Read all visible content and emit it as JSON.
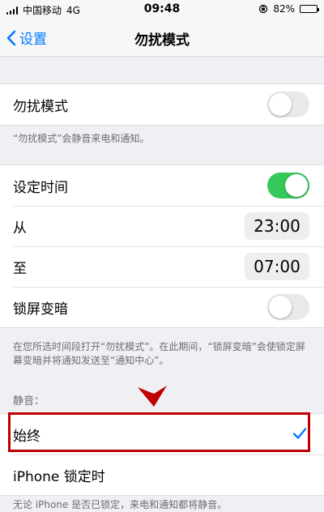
{
  "status_bar": {
    "carrier": "中国移动",
    "network": "4G",
    "time": "09:48",
    "battery": "82%"
  },
  "nav": {
    "back_label": "设置",
    "title": "勿扰模式"
  },
  "dnd": {
    "label": "勿扰模式",
    "enabled": false,
    "footnote": "“勿扰模式”会静音来电和通知。"
  },
  "schedule": {
    "label": "设定时间",
    "enabled": true,
    "from_label": "从",
    "from_time": "23:00",
    "to_label": "至",
    "to_time": "07:00",
    "dim_label": "锁屏变暗",
    "dim_enabled": false,
    "footnote": "在您所选时间段打开“勿扰模式”。在此期间，“锁屏变暗”会使锁定屏幕变暗并将通知发送至“通知中心”。"
  },
  "silence": {
    "header": "静音：",
    "always_label": "始终",
    "locked_label": "iPhone 锁定时",
    "footnote": "无论 iPhone 是否已锁定，来电和通知都将静音。"
  },
  "colors": {
    "accent": "#007aff",
    "toggle_on": "#34c759",
    "highlight": "#c00000"
  }
}
